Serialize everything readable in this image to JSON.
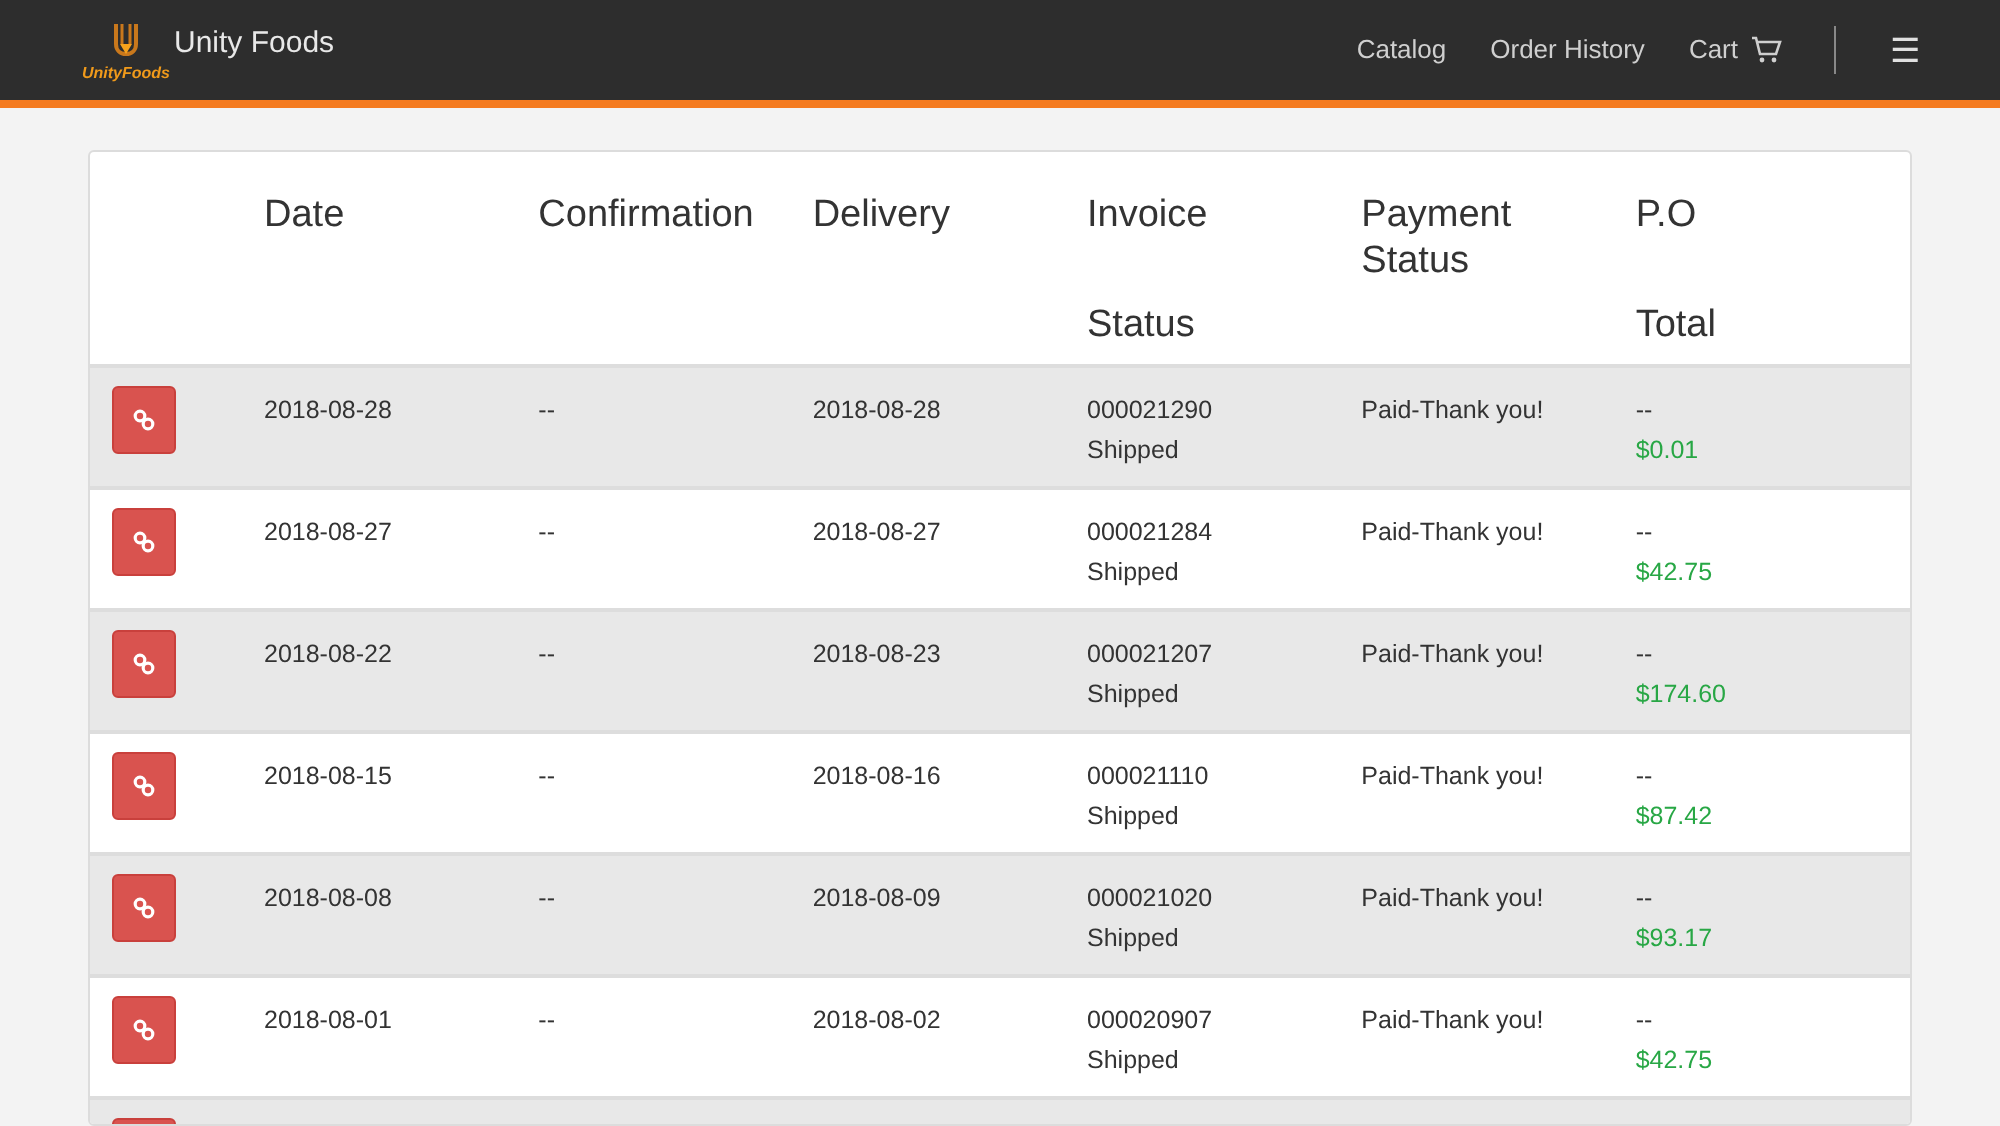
{
  "navbar": {
    "brand": "Unity Foods",
    "logo_text": "UnityFoods",
    "links": [
      {
        "label": "Catalog"
      },
      {
        "label": "Order History"
      },
      {
        "label": "Cart"
      }
    ],
    "menu_icon": "☰"
  },
  "table": {
    "columns": [
      "Date",
      "Confirmation",
      "Delivery",
      "Invoice",
      "Payment Status",
      "P.O"
    ],
    "subcolumns": [
      "Status",
      "Total"
    ],
    "rows": [
      {
        "date": "2018-08-28",
        "confirmation": "--",
        "delivery": "2018-08-28",
        "invoice": "000021290",
        "status": "Shipped",
        "payment": "Paid-Thank you!",
        "po": "--",
        "total": "$0.01"
      },
      {
        "date": "2018-08-27",
        "confirmation": "--",
        "delivery": "2018-08-27",
        "invoice": "000021284",
        "status": "Shipped",
        "payment": "Paid-Thank you!",
        "po": "--",
        "total": "$42.75"
      },
      {
        "date": "2018-08-22",
        "confirmation": "--",
        "delivery": "2018-08-23",
        "invoice": "000021207",
        "status": "Shipped",
        "payment": "Paid-Thank you!",
        "po": "--",
        "total": "$174.60"
      },
      {
        "date": "2018-08-15",
        "confirmation": "--",
        "delivery": "2018-08-16",
        "invoice": "000021110",
        "status": "Shipped",
        "payment": "Paid-Thank you!",
        "po": "--",
        "total": "$87.42"
      },
      {
        "date": "2018-08-08",
        "confirmation": "--",
        "delivery": "2018-08-09",
        "invoice": "000021020",
        "status": "Shipped",
        "payment": "Paid-Thank you!",
        "po": "--",
        "total": "$93.17"
      },
      {
        "date": "2018-08-01",
        "confirmation": "--",
        "delivery": "2018-08-02",
        "invoice": "000020907",
        "status": "Shipped",
        "payment": "Paid-Thank you!",
        "po": "--",
        "total": "$42.75"
      }
    ]
  }
}
